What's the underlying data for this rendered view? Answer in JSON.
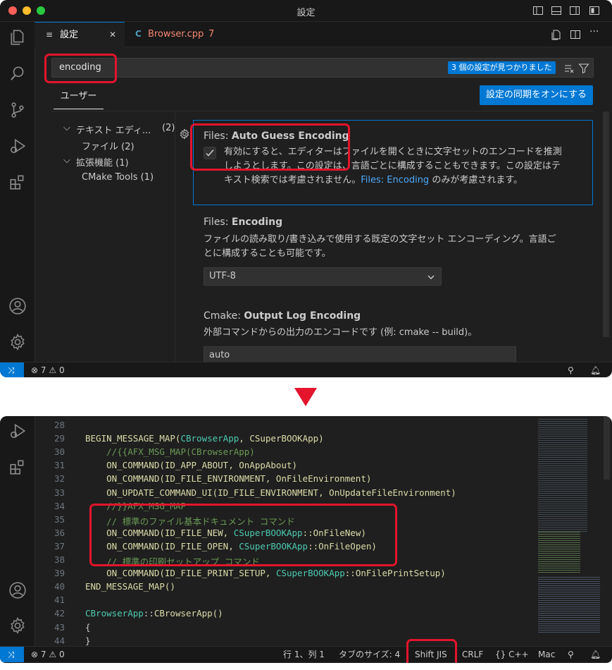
{
  "window_title": "設定",
  "tabs": [
    {
      "label": "設定",
      "close": "✕"
    },
    {
      "label": "Browser.cpp",
      "badge": "7"
    }
  ],
  "search": {
    "value": "encoding",
    "result_badge": "3 個の設定が見つかりました"
  },
  "scope_tab": "ユーザー",
  "sync_button": "設定の同期をオンにする",
  "toc": [
    {
      "label": "テキスト エディ...",
      "count": "(2)"
    },
    {
      "label": "ファイル (2)"
    },
    {
      "label": "拡張機能 (1)"
    },
    {
      "label": "CMake Tools (1)"
    }
  ],
  "settings": [
    {
      "category": "Files: ",
      "name": "Auto Guess Encoding",
      "checked": true,
      "desc_lines": [
        "有効にすると、エディターはファイルを開くときに文字セットのエンコードを推測",
        "しようとします。この設定は、言語ごとに構成することもできます。この設定はテ"
      ],
      "desc_last_pre": "キスト検索では考慮されません。",
      "desc_link": "Files: Encoding",
      "desc_last_post": " のみが考慮されます。"
    },
    {
      "category": "Files: ",
      "name": "Encoding",
      "desc_lines": [
        "ファイルの読み取り/書き込みで使用する既定の文字セット エンコーディング。言語ご",
        "とに構成することも可能です。"
      ],
      "select_value": "UTF-8"
    },
    {
      "category": "Cmake: ",
      "name": "Output Log Encoding",
      "desc_lines": [
        "外部コマンドからの出力のエンコードです (例: cmake -- build)。"
      ],
      "input_value": "auto"
    }
  ],
  "status1": {
    "errors": "7",
    "warnings": "0"
  },
  "code_lines": [
    {
      "n": "28",
      "parts": []
    },
    {
      "n": "29",
      "parts": [
        {
          "t": "BEGIN_MESSAGE_MAP(",
          "c": "kw"
        },
        {
          "t": "CBrowserApp",
          "c": "ty"
        },
        {
          "t": ", CSuperBOOKApp)",
          "c": "kw"
        }
      ]
    },
    {
      "n": "30",
      "parts": [
        {
          "t": "    //{{AFX_MSG_MAP(CBrowserApp)",
          "c": "cm"
        }
      ]
    },
    {
      "n": "31",
      "parts": [
        {
          "t": "    ON_COMMAND(ID_APP_ABOUT, OnAppAbout)",
          "c": "kw"
        }
      ]
    },
    {
      "n": "32",
      "parts": [
        {
          "t": "    ON_COMMAND(ID_FILE_ENVIRONMENT, OnFileEnvironment)",
          "c": "kw"
        }
      ]
    },
    {
      "n": "33",
      "parts": [
        {
          "t": "    ON_UPDATE_COMMAND_UI(ID_FILE_ENVIRONMENT, OnUpdateFileEnvironment)",
          "c": "kw"
        }
      ]
    },
    {
      "n": "34",
      "parts": [
        {
          "t": "    //}}AFX_MSG_MAP",
          "c": "cm"
        }
      ]
    },
    {
      "n": "35",
      "parts": [
        {
          "t": "    // 標準のファイル基本ドキュメント コマンド",
          "c": "cm"
        }
      ]
    },
    {
      "n": "36",
      "parts": [
        {
          "t": "    ON_COMMAND(ID_FILE_NEW, ",
          "c": "kw"
        },
        {
          "t": "CSuperBOOKApp",
          "c": "ty"
        },
        {
          "t": "::OnFileNew)",
          "c": "kw"
        }
      ]
    },
    {
      "n": "37",
      "parts": [
        {
          "t": "    ON_COMMAND(ID_FILE_OPEN, ",
          "c": "kw"
        },
        {
          "t": "CSuperBOOKApp",
          "c": "ty"
        },
        {
          "t": "::OnFileOpen)",
          "c": "kw"
        }
      ]
    },
    {
      "n": "38",
      "parts": [
        {
          "t": "    // 標準の印刷セットアップ コマンド",
          "c": "cm"
        }
      ]
    },
    {
      "n": "39",
      "parts": [
        {
          "t": "    ON_COMMAND(ID_FILE_PRINT_SETUP, ",
          "c": "kw"
        },
        {
          "t": "CSuperBOOKApp",
          "c": "ty"
        },
        {
          "t": "::OnFilePrintSetup)",
          "c": "kw"
        }
      ]
    },
    {
      "n": "40",
      "parts": [
        {
          "t": "END_MESSAGE_MAP()",
          "c": "kw"
        }
      ]
    },
    {
      "n": "41",
      "parts": []
    },
    {
      "n": "42",
      "parts": [
        {
          "t": "CBrowserApp",
          "c": "ty"
        },
        {
          "t": "::",
          "c": ""
        },
        {
          "t": "CBrowserApp()",
          "c": "kw"
        }
      ]
    },
    {
      "n": "43",
      "parts": [
        {
          "t": "{",
          "c": ""
        }
      ]
    },
    {
      "n": "44",
      "parts": [
        {
          "t": "}",
          "c": ""
        }
      ]
    }
  ],
  "status2": {
    "errors": "7",
    "warnings": "0",
    "position": "行 1、列 1",
    "tab_size": "タブのサイズ: 4",
    "encoding": "Shift JIS",
    "eol": "CRLF",
    "lang_brace": "{}",
    "language": "C++",
    "platform": "Mac"
  },
  "colors": {
    "accent": "#0078d4",
    "highlight": "#e3142c",
    "arrow": "#e3142c"
  }
}
